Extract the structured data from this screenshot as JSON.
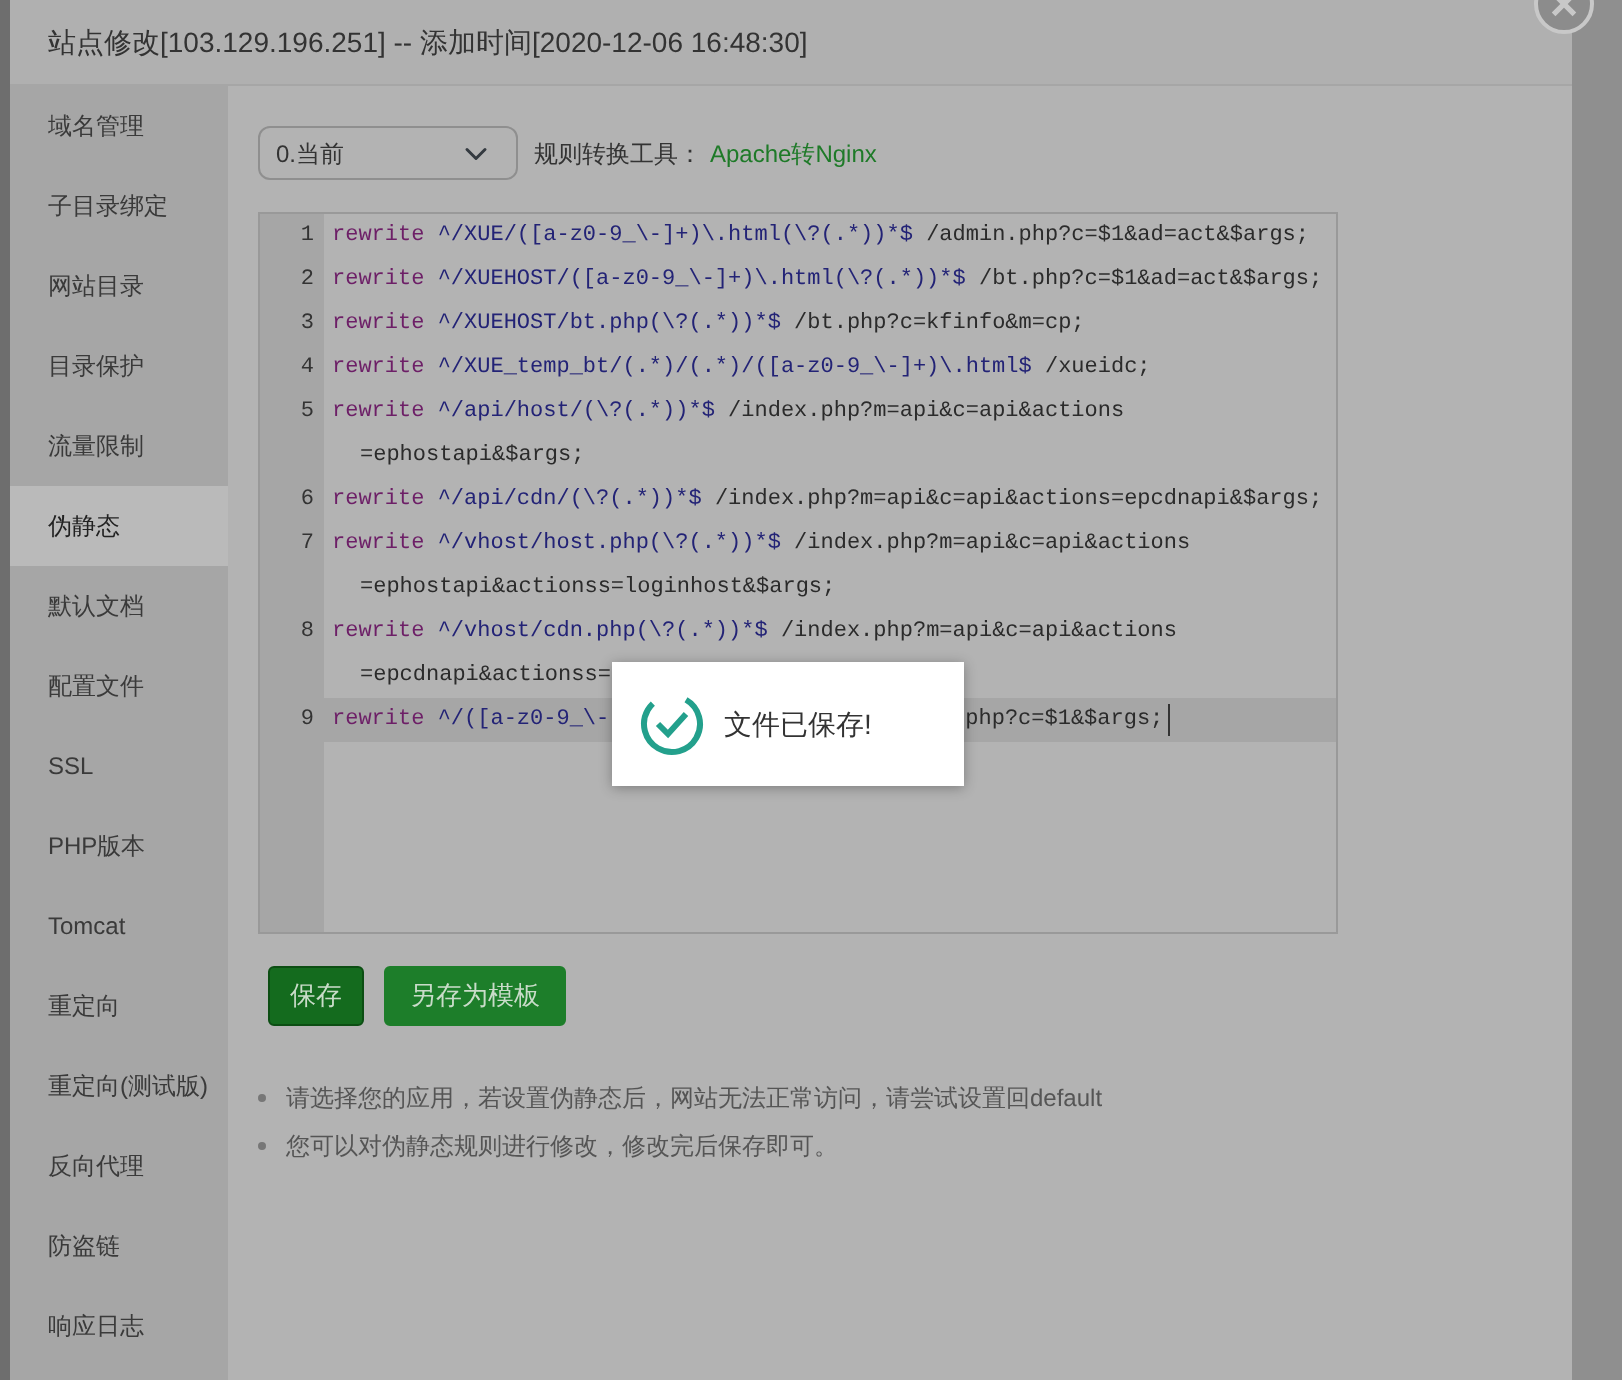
{
  "dialog": {
    "title": "站点修改[103.129.196.251] -- 添加时间[2020-12-06 16:48:30]"
  },
  "sidebar": {
    "items": [
      {
        "label": "域名管理",
        "selected": false
      },
      {
        "label": "子目录绑定",
        "selected": false
      },
      {
        "label": "网站目录",
        "selected": false
      },
      {
        "label": "目录保护",
        "selected": false
      },
      {
        "label": "流量限制",
        "selected": false
      },
      {
        "label": "伪静态",
        "selected": true
      },
      {
        "label": "默认文档",
        "selected": false
      },
      {
        "label": "配置文件",
        "selected": false
      },
      {
        "label": "SSL",
        "selected": false
      },
      {
        "label": "PHP版本",
        "selected": false
      },
      {
        "label": "Tomcat",
        "selected": false
      },
      {
        "label": "重定向",
        "selected": false
      },
      {
        "label": "重定向(测试版)",
        "selected": false
      },
      {
        "label": "反向代理",
        "selected": false
      },
      {
        "label": "防盗链",
        "selected": false
      },
      {
        "label": "响应日志",
        "selected": false
      }
    ]
  },
  "toolbar": {
    "select_value": "0.当前",
    "tool_label": "规则转换工具：",
    "tool_link": "Apache转Nginx"
  },
  "editor": {
    "lines": [
      {
        "number": "1",
        "keyword": "rewrite",
        "pattern": "^/XUE/([a-z0-9_\\-]+)\\.html(\\?(.*))*$",
        "target": "/admin.php?c=$1&ad=act&$args;",
        "active": false
      },
      {
        "number": "2",
        "keyword": "rewrite",
        "pattern": "^/XUEHOST/([a-z0-9_\\-]+)\\.html(\\?(.*))*$",
        "target": "/bt.php?c=$1&ad=act&$args;",
        "active": false
      },
      {
        "number": "3",
        "keyword": "rewrite",
        "pattern": "^/XUEHOST/bt.php(\\?(.*))*$",
        "target": "/bt.php?c=kfinfo&m=cp;",
        "active": false
      },
      {
        "number": "4",
        "keyword": "rewrite",
        "pattern": "^/XUE_temp_bt/(.*)/(.*)/([a-z0-9_\\-]+)\\.html$",
        "target": "/xueidc;",
        "active": false
      },
      {
        "number": "5",
        "keyword": "rewrite",
        "pattern": "^/api/host/(\\?(.*))*$",
        "target": "/index.php?m=api&c=api&actions",
        "continuation": "=ephostapi&$args;",
        "active": false
      },
      {
        "number": "6",
        "keyword": "rewrite",
        "pattern": "^/api/cdn/(\\?(.*))*$",
        "target": "/index.php?m=api&c=api&actions=epcdnapi&$args;",
        "active": false
      },
      {
        "number": "7",
        "keyword": "rewrite",
        "pattern": "^/vhost/host.php(\\?(.*))*$",
        "target": "/index.php?m=api&c=api&actions",
        "continuation": "=ephostapi&actionss=loginhost&$args;",
        "active": false
      },
      {
        "number": "8",
        "keyword": "rewrite",
        "pattern": "^/vhost/cdn.php(\\?(.*))*$",
        "target": "/index.php?m=api&c=api&actions",
        "continuation": "=epcdnapi&actionss=",
        "active": false
      },
      {
        "number": "9",
        "keyword": "rewrite",
        "pattern": "^/([a-z0-9_\\-",
        "target": "php?c=$1&$args;",
        "hidden_by_toast": true,
        "active": true
      }
    ]
  },
  "toast": {
    "message": "文件已保存!"
  },
  "buttons": [
    {
      "label": "保存",
      "kind": "primary"
    },
    {
      "label": "另存为模板",
      "kind": "secondary"
    }
  ],
  "notes": [
    "请选择您的应用，若设置伪静态后，网站无法正常访问，请尝试设置回default",
    "您可以对伪静态规则进行修改，修改完后保存即可。"
  ]
}
